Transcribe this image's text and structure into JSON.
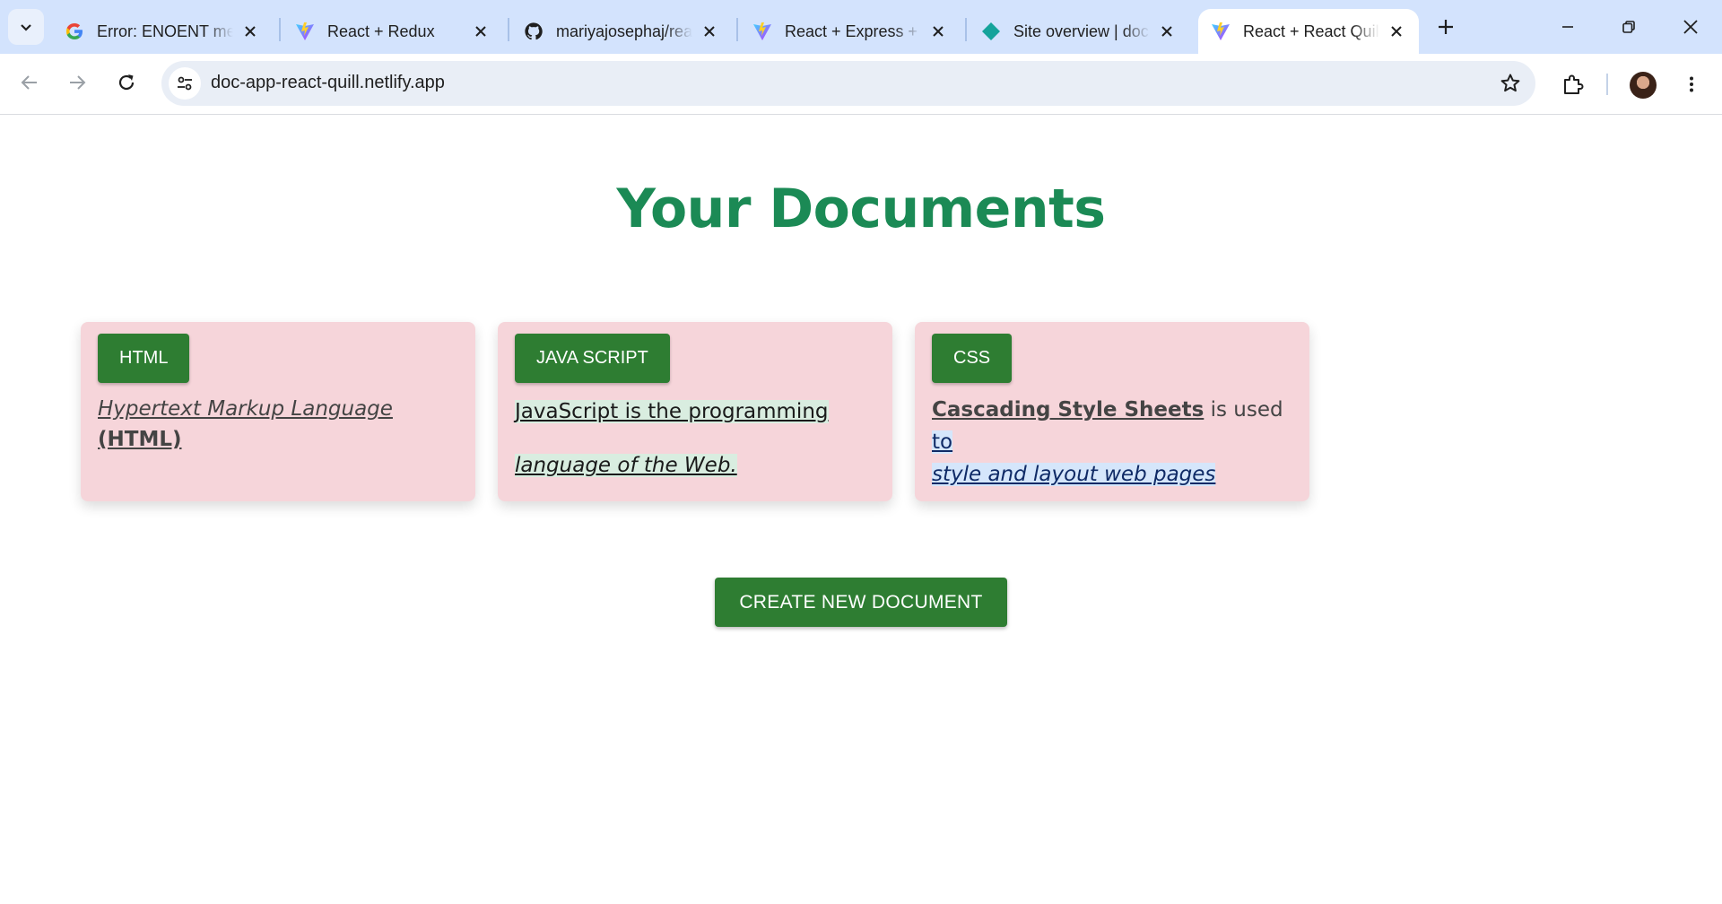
{
  "browser": {
    "tabs": [
      {
        "title": "Error: ENOENT mea",
        "icon": "google-icon",
        "active": false
      },
      {
        "title": "React + Redux",
        "icon": "vite-icon",
        "active": false
      },
      {
        "title": "mariyajosephaj/rea",
        "icon": "github-icon",
        "active": false
      },
      {
        "title": "React + Express + ",
        "icon": "vite-icon",
        "active": false
      },
      {
        "title": "Site overview | doc",
        "icon": "netlify-icon",
        "active": false
      },
      {
        "title": "React + React Quill",
        "icon": "vite-icon",
        "active": true
      }
    ],
    "url": "doc-app-react-quill.netlify.app"
  },
  "page": {
    "title": "Your Documents",
    "documents": [
      {
        "button": "HTML",
        "line1_italic": "Hypertext Markup Language ",
        "line1_bold": "(HTML)"
      },
      {
        "button": "JAVA SCRIPT",
        "line1": "JavaScript is the programming",
        "line2": " language of the Web."
      },
      {
        "button": "CSS",
        "bold": "Cascading Style Sheets",
        "plain": " is used ",
        "hl1": "to",
        "hl2": "style and layout web pages"
      }
    ],
    "create_button": "CREATE NEW DOCUMENT"
  },
  "colors": {
    "heading": "#1b8a55",
    "button": "#2e7d32",
    "card": "#f6d5da",
    "tabstrip": "#d3e3fd"
  }
}
